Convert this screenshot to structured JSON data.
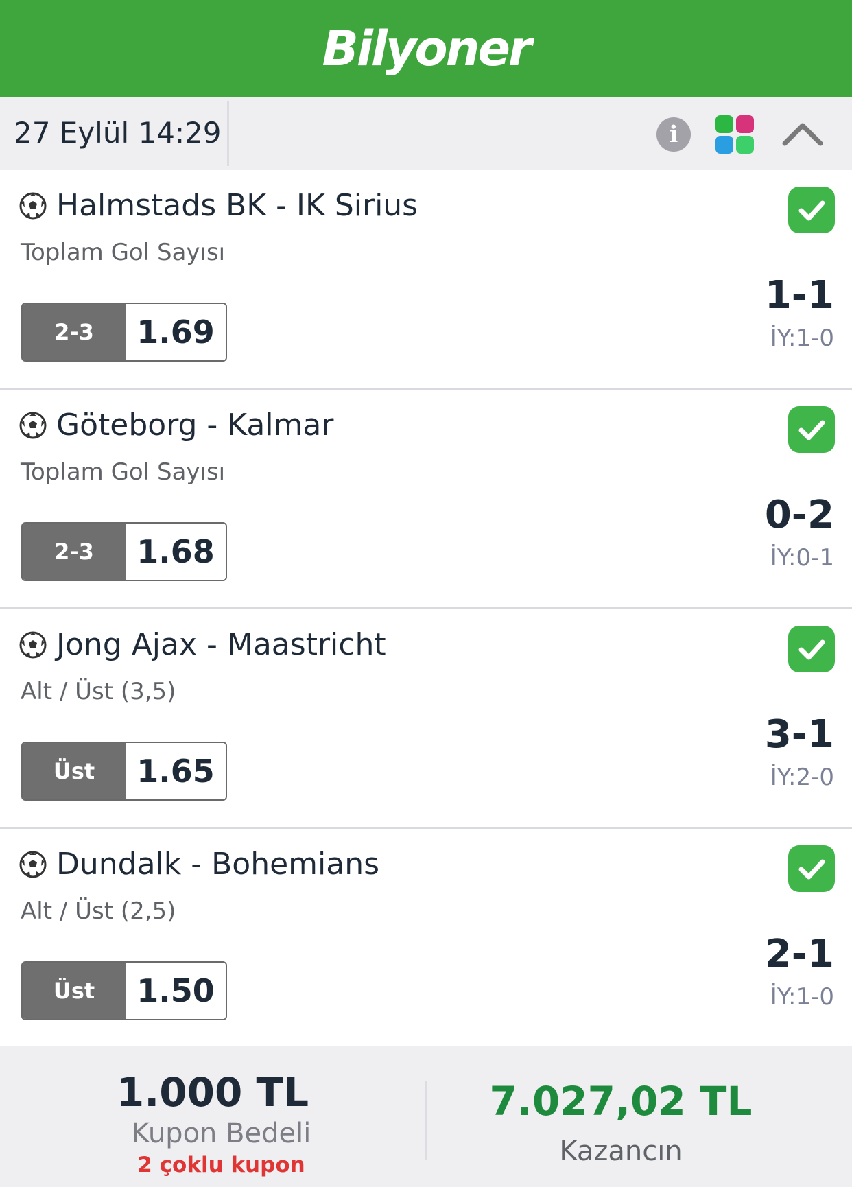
{
  "header": {
    "logo": "Bilyoner",
    "brand_color": "#3ea63c"
  },
  "subbar": {
    "datetime": "27 Eylül 14:29",
    "icons": [
      "info-icon",
      "share-icon",
      "chevron-up-icon"
    ]
  },
  "matches": [
    {
      "teams": "Halmstads BK - IK Sirius",
      "market": "Toplam Gol Sayısı",
      "pick": "2-3",
      "odd": "1.69",
      "score": "1-1",
      "halftime": "İY:1-0",
      "status": "won"
    },
    {
      "teams": "Göteborg - Kalmar",
      "market": "Toplam Gol Sayısı",
      "pick": "2-3",
      "odd": "1.68",
      "score": "0-2",
      "halftime": "İY:0-1",
      "status": "won"
    },
    {
      "teams": "Jong Ajax - Maastricht",
      "market": "Alt / Üst (3,5)",
      "pick": "Üst",
      "odd": "1.65",
      "score": "3-1",
      "halftime": "İY:2-0",
      "status": "won"
    },
    {
      "teams": "Dundalk - Bohemians",
      "market": "Alt / Üst (2,5)",
      "pick": "Üst",
      "odd": "1.50",
      "score": "2-1",
      "halftime": "İY:1-0",
      "status": "won"
    }
  ],
  "footer": {
    "stake": "1.000 TL",
    "stake_label": "Kupon Bedeli",
    "multi_label": "2 çoklu kupon",
    "winnings": "7.027,02 TL",
    "winnings_label": "Kazancın",
    "win_color": "#1e8a3d"
  }
}
